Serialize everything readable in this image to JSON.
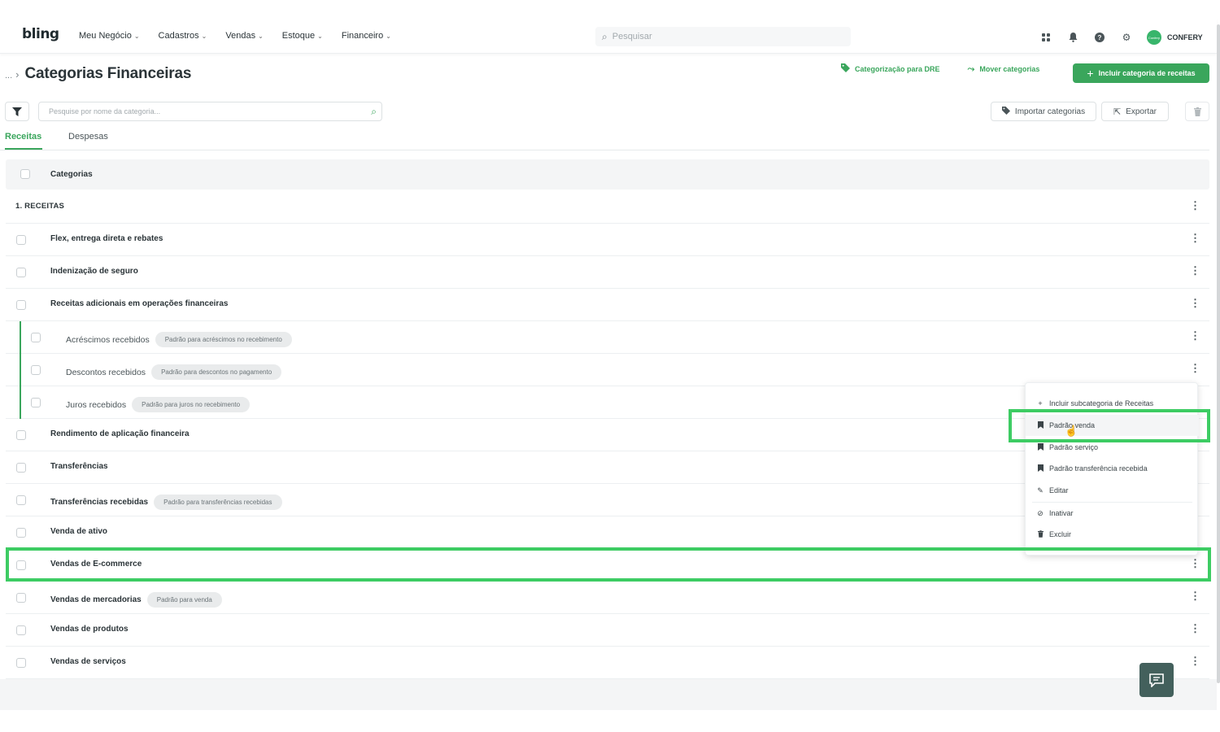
{
  "app": {
    "logo": "bling",
    "user": "CONFERY",
    "avatar_text": "Confery"
  },
  "nav": [
    {
      "label": "Meu Negócio"
    },
    {
      "label": "Cadastros"
    },
    {
      "label": "Vendas"
    },
    {
      "label": "Estoque"
    },
    {
      "label": "Financeiro"
    }
  ],
  "search": {
    "placeholder": "Pesquisar"
  },
  "header": {
    "breadcrumb_dots": "...",
    "title": "Categorias Financeiras",
    "dre_label": "Categorização para DRE",
    "move_label": "Mover categorias",
    "primary_label": "Incluir categoria de receitas"
  },
  "filter": {
    "search_placeholder": "Pesquise por nome da categoria...",
    "import_label": "Importar categorias",
    "export_label": "Exportar"
  },
  "tabs": [
    {
      "label": "Receitas",
      "active": true
    },
    {
      "label": "Despesas",
      "active": false
    }
  ],
  "table": {
    "header": "Categorias",
    "rows": [
      {
        "name": "1. RECEITAS",
        "badge": ""
      },
      {
        "name": "Flex, entrega direta e rebates",
        "badge": ""
      },
      {
        "name": "Indenização de seguro",
        "badge": ""
      },
      {
        "name": "Receitas adicionais em operações financeiras",
        "badge": ""
      },
      {
        "name": "Acréscimos recebidos",
        "badge": "Padrão para acréscimos no recebimento"
      },
      {
        "name": "Descontos recebidos",
        "badge": "Padrão para descontos no pagamento"
      },
      {
        "name": "Juros recebidos",
        "badge": "Padrão para juros no recebimento"
      },
      {
        "name": "Rendimento de aplicação financeira",
        "badge": ""
      },
      {
        "name": "Transferências",
        "badge": ""
      },
      {
        "name": "Transferências recebidas",
        "badge": "Padrão para transferências recebidas"
      },
      {
        "name": "Venda de ativo",
        "badge": ""
      },
      {
        "name": "Vendas de E-commerce",
        "badge": ""
      },
      {
        "name": "Vendas de mercadorias",
        "badge": "Padrão para venda"
      },
      {
        "name": "Vendas de produtos",
        "badge": ""
      },
      {
        "name": "Vendas de serviços",
        "badge": ""
      }
    ]
  },
  "context_menu": {
    "items": [
      {
        "label": "Incluir subcategoria de Receitas",
        "icon": "plus-icon"
      },
      {
        "label": "Padrão venda",
        "icon": "bookmark-icon"
      },
      {
        "label": "Padrão serviço",
        "icon": "bookmark-icon"
      },
      {
        "label": "Padrão transferência recebida",
        "icon": "bookmark-icon"
      },
      {
        "label": "Editar",
        "icon": "pencil-icon"
      },
      {
        "label": "Inativar",
        "icon": "ban-icon"
      },
      {
        "label": "Excluir",
        "icon": "trash-icon"
      }
    ]
  },
  "colors": {
    "accent": "#3aa65c",
    "highlight": "#3dcc63",
    "chat": "#43605c"
  }
}
